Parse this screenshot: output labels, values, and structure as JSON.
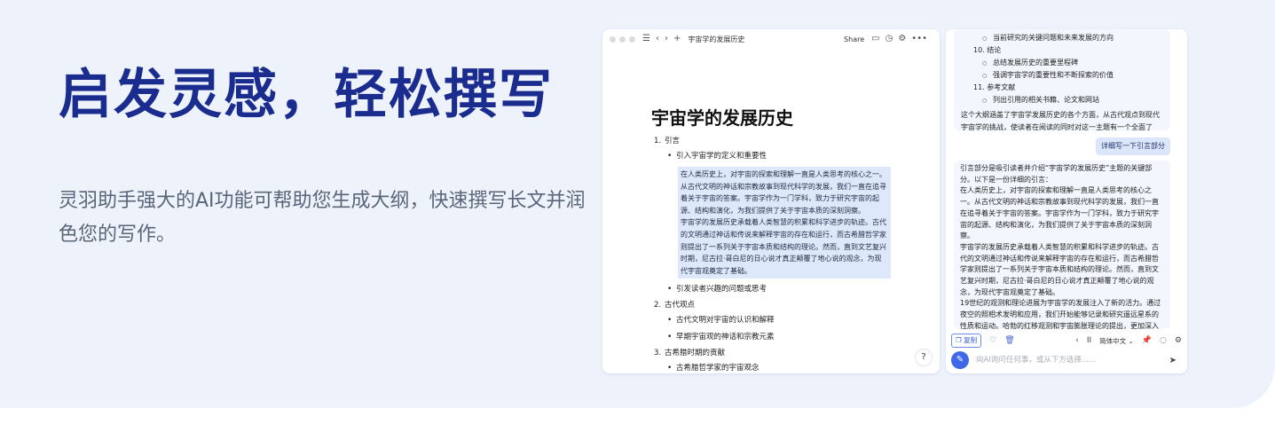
{
  "hero": {
    "headline": "启发灵感，轻松撰写",
    "description": "灵羽助手强大的AI功能可帮助您生成大纲，快速撰写长文并润色您的写作。"
  },
  "doc_window": {
    "breadcrumb": "宇宙学的发展历史",
    "share_label": "Share",
    "icons": [
      "menu-icon",
      "chevron-left-icon",
      "chevron-right-icon",
      "plus-icon",
      "comment-icon",
      "clock-icon",
      "settings-icon",
      "more-icon",
      "help-icon"
    ],
    "help_label": "?",
    "title": "宇宙学的发展历史",
    "outline": {
      "item1": "1.",
      "item1_label": "引言",
      "b1": "引入宇宙学的定义和重要性",
      "para1": "在人类历史上，对宇宙的探索和理解一直是人类思考的核心之一。从古代文明的神话和宗教故事到现代科学的发展，我们一直在追寻着关于宇宙的答案。宇宙学作为一门学科，致力于研究宇宙的起源、结构和演化，为我们提供了关于宇宙本质的深刻洞察。",
      "para2": "宇宙学的发展历史承载着人类智慧的积累和科学进步的轨迹。古代的文明通过神话和传说来解释宇宙的存在和运行，而古希腊哲学家则提出了一系列关于宇宙本质和结构的理论。然而，直到文艺复兴时期，尼古拉·哥白尼的日心说才真正颠覆了地心说的观念，为现代宇宙观奠定了基础。",
      "b2": "引发读者兴趣的问题或思考",
      "item2": "2.",
      "item2_label": "古代观点",
      "b3": "古代文明对宇宙的认识和解释",
      "b4": "早期宇宙观的神话和宗教元素",
      "item3": "3.",
      "item3_label": "古希腊时期的贡献",
      "b5": "古希腊哲学家的宇宙观念"
    }
  },
  "ai_panel": {
    "card1": {
      "l0": "当前研究的关键问题和未来发展的方向",
      "l1": "10. 结论",
      "l2": "总结发展历史的重要里程碑",
      "l3": "强调宇宙学的重要性和不断探索的价值",
      "l4": "11. 参考文献",
      "l5": "列出引用的相关书籍、论文和网站",
      "summary": "这个大纲涵盖了宇宙学发展历史的各个方面，从古代观点到现代宇宙学的挑战，使读者在阅读的同时对这一主题有一个全面了解。"
    },
    "user_request": "详细写一下引言部分",
    "card2": {
      "intro": "引言部分是吸引读者并介绍“宇宙学的发展历史”主题的关键部分。以下是一份详细的引言：",
      "p1": "在人类历史上，对宇宙的探索和理解一直是人类思考的核心之一。从古代文明的神话和宗教故事到现代科学的发展，我们一直在追寻着关于宇宙的答案。宇宙学作为一门学科，致力于研究宇宙的起源、结构和演化，为我们提供了关于宇宙本质的深刻洞察。",
      "p2": "宇宙学的发展历史承载着人类智慧的积累和科学进步的轨迹。古代的文明通过神话和传说来解释宇宙的存在和运行，而古希腊哲学家则提出了一系列关于宇宙本质和结构的理论。然而，直到文艺复兴时期，尼古拉·哥白尼的日心说才真正颠覆了地心说的观念，为现代宇宙观奠定了基础。",
      "p3": "19世纪的观测和理论进展为宇宙学的发展注入了新的活力。通过夜空的照相术发明和应用，我们开始能够记录和研究遥远星系的性质和运动。哈勃的红移观测和宇宙膨胀理论的提出，更加深入地揭示了宇宙的奥秘。"
    },
    "toolbar": {
      "copy_label": "复制",
      "pagination": "II",
      "language": "简体中文"
    },
    "input_placeholder": "向AI询问任何事，或从下方选择......"
  }
}
